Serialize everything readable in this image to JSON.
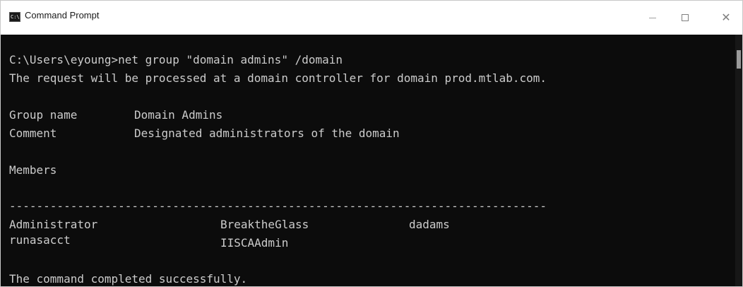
{
  "window": {
    "title": "Command Prompt",
    "app_icon_text": "C:\\"
  },
  "console": {
    "command_line": "C:\\Users\\eyoung>net group \"domain admins\" /domain",
    "request_line": "The request will be processed at a domain controller for domain prod.mtlab.com.",
    "group_name_label": "Group name",
    "group_name_value": "Domain Admins",
    "comment_label": "Comment",
    "comment_value": "Designated administrators of the domain",
    "members_label": "Members",
    "separator": "-------------------------------------------------------------------------------",
    "members": [
      [
        "Administrator",
        "BreaktheGlass",
        "dadams"
      ],
      [
        "runasacct",
        "IISCAAdmin",
        ""
      ]
    ],
    "completion": "The command completed successfully."
  },
  "colors": {
    "console_bg": "#0c0c0c",
    "console_text": "#cccccc",
    "titlebar_bg": "#ffffff"
  }
}
